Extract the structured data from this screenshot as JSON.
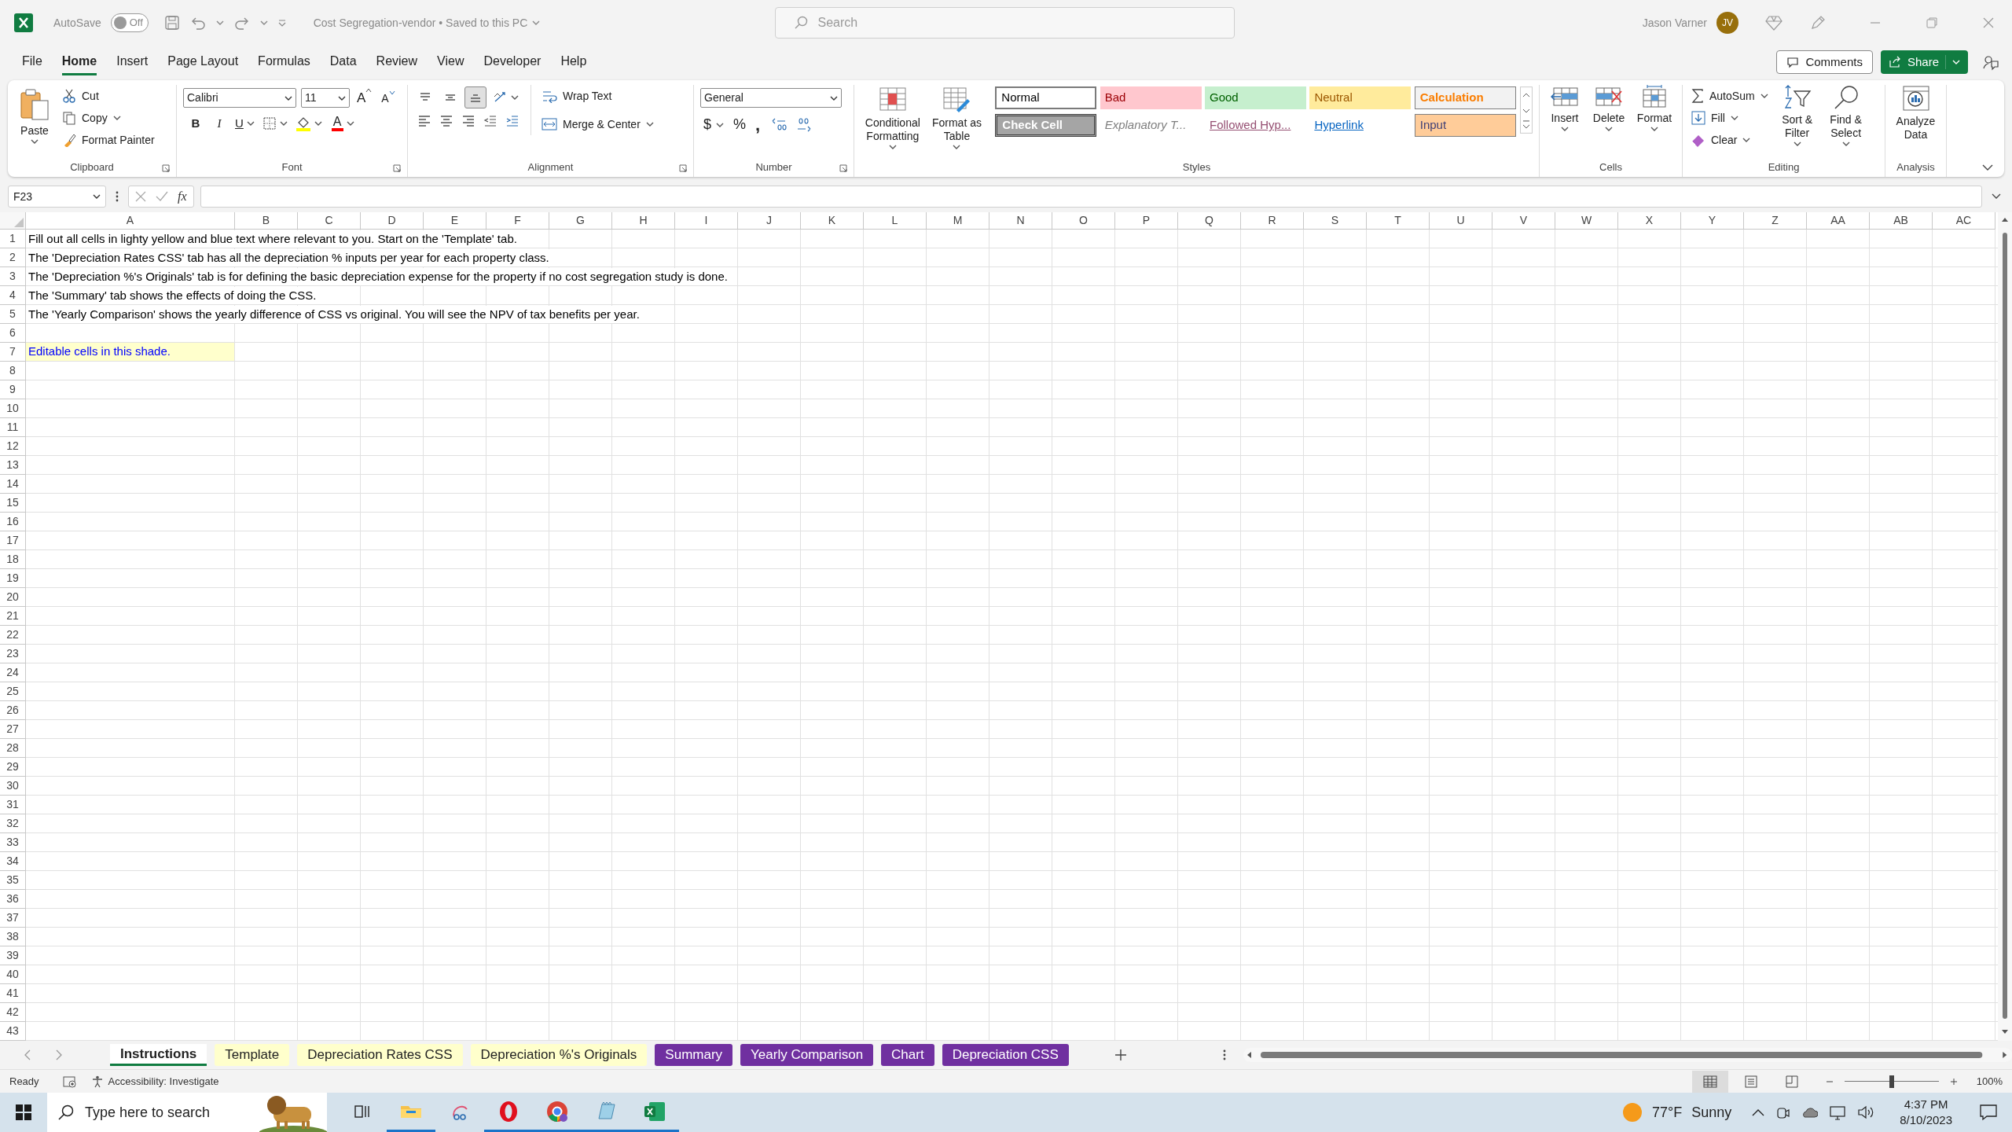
{
  "title_bar": {
    "autosave_label": "AutoSave",
    "autosave_toggle": {
      "label": "Off",
      "on": false
    },
    "document_title": "Cost Segregation-vendor • Saved to this PC",
    "search_placeholder": "Search",
    "user_name": "Jason Varner",
    "avatar_initials": "JV"
  },
  "menu_tabs": [
    {
      "label": "File",
      "selected": false
    },
    {
      "label": "Home",
      "selected": true
    },
    {
      "label": "Insert",
      "selected": false
    },
    {
      "label": "Page Layout",
      "selected": false
    },
    {
      "label": "Formulas",
      "selected": false
    },
    {
      "label": "Data",
      "selected": false
    },
    {
      "label": "Review",
      "selected": false
    },
    {
      "label": "View",
      "selected": false
    },
    {
      "label": "Developer",
      "selected": false
    },
    {
      "label": "Help",
      "selected": false
    }
  ],
  "comments_button": "Comments",
  "share_button": "Share",
  "ribbon": {
    "clipboard": {
      "title": "Clipboard",
      "paste": "Paste",
      "cut": "Cut",
      "copy": "Copy",
      "format_painter": "Format Painter"
    },
    "font": {
      "title": "Font",
      "font_name": "Calibri",
      "font_size": "11",
      "grow_font": "A",
      "shrink_font": "A",
      "bold": "B",
      "italic": "I",
      "underline": "U",
      "font_color": "A"
    },
    "alignment": {
      "title": "Alignment",
      "vertical_align": [
        {
          "kind": "top",
          "selected": false
        },
        {
          "kind": "middle",
          "selected": false
        },
        {
          "kind": "bottom",
          "selected": true
        }
      ],
      "wrap_text": "Wrap Text",
      "merge_center": "Merge & Center"
    },
    "number": {
      "title": "Number",
      "format": "General",
      "currency": "$",
      "percent": "%",
      "comma": ","
    },
    "styles": {
      "title": "Styles",
      "conditional_formatting": "Conditional Formatting",
      "format_as_table": "Format as Table",
      "items": [
        {
          "label": "Normal",
          "kind": "normal"
        },
        {
          "label": "Bad",
          "kind": "bad"
        },
        {
          "label": "Good",
          "kind": "good"
        },
        {
          "label": "Neutral",
          "kind": "neutral"
        },
        {
          "label": "Calculation",
          "kind": "calculation"
        },
        {
          "label": "Check Cell",
          "kind": "check"
        },
        {
          "label": "Explanatory T...",
          "kind": "explanatory"
        },
        {
          "label": "Followed Hyp...",
          "kind": "followed"
        },
        {
          "label": "Hyperlink",
          "kind": "hyperlink"
        },
        {
          "label": "Input",
          "kind": "input"
        }
      ]
    },
    "cells": {
      "title": "Cells",
      "insert": "Insert",
      "delete": "Delete",
      "format": "Format"
    },
    "editing": {
      "title": "Editing",
      "autosum": "AutoSum",
      "fill": "Fill",
      "clear": "Clear",
      "sort_filter": "Sort & Filter",
      "find_select": "Find & Select"
    },
    "analysis": {
      "title": "Analysis",
      "analyze_data": "Analyze Data"
    }
  },
  "formula_bar": {
    "name_box": "F23",
    "function_label": "fx"
  },
  "sheet": {
    "columns": [
      "A",
      "B",
      "C",
      "D",
      "E",
      "F",
      "G",
      "H",
      "I",
      "J",
      "K",
      "L",
      "M",
      "N",
      "O",
      "P",
      "Q",
      "R",
      "S",
      "T",
      "U",
      "V",
      "W",
      "X",
      "Y",
      "Z",
      "AA",
      "AB",
      "AC"
    ],
    "rows": [
      {
        "number": "1",
        "kind": "text",
        "text": "Fill out all cells in lighty yellow and blue text where relevant to you. Start on the 'Template' tab."
      },
      {
        "number": "2",
        "kind": "text",
        "text": "The 'Depreciation Rates CSS' tab has all the depreciation % inputs per year for each property class."
      },
      {
        "number": "3",
        "kind": "text",
        "text": "The 'Depreciation %'s Originals' tab is for defining the basic depreciation expense for the property if no cost segregation study is done."
      },
      {
        "number": "4",
        "kind": "text",
        "text": "The 'Summary' tab shows the effects of doing the CSS."
      },
      {
        "number": "5",
        "kind": "text",
        "text": "The 'Yearly Comparison' shows the yearly difference of CSS vs original. You will see the NPV of tax benefits per year."
      },
      {
        "number": "6"
      },
      {
        "number": "7",
        "kind": "editable",
        "text": "Editable cells in this shade."
      },
      {
        "number": "8"
      },
      {
        "number": "9"
      },
      {
        "number": "10"
      },
      {
        "number": "11"
      },
      {
        "number": "12"
      },
      {
        "number": "13"
      },
      {
        "number": "14"
      },
      {
        "number": "15"
      },
      {
        "number": "16"
      },
      {
        "number": "17"
      },
      {
        "number": "18"
      },
      {
        "number": "19"
      },
      {
        "number": "20"
      },
      {
        "number": "21"
      },
      {
        "number": "22"
      },
      {
        "number": "23"
      },
      {
        "number": "24"
      },
      {
        "number": "25"
      },
      {
        "number": "26"
      },
      {
        "number": "27"
      },
      {
        "number": "28"
      },
      {
        "number": "29"
      },
      {
        "number": "30"
      },
      {
        "number": "31"
      },
      {
        "number": "32"
      },
      {
        "number": "33"
      },
      {
        "number": "34"
      },
      {
        "number": "35"
      },
      {
        "number": "36"
      },
      {
        "number": "37"
      },
      {
        "number": "38"
      },
      {
        "number": "39"
      },
      {
        "number": "40"
      },
      {
        "number": "41"
      },
      {
        "number": "42"
      },
      {
        "number": "43"
      }
    ]
  },
  "sheet_tabs": [
    {
      "label": "Instructions",
      "selected": true,
      "color": "#ffffff"
    },
    {
      "label": "Template",
      "selected": false,
      "color": "#ffffcc"
    },
    {
      "label": "Depreciation Rates CSS",
      "selected": false,
      "color": "#ffffcc"
    },
    {
      "label": "Depreciation %'s Originals",
      "selected": false,
      "color": "#ffffcc"
    },
    {
      "label": "Summary",
      "selected": false,
      "color": "#7030a0"
    },
    {
      "label": "Yearly Comparison",
      "selected": false,
      "color": "#7030a0"
    },
    {
      "label": "Chart",
      "selected": false,
      "color": "#7030a0"
    },
    {
      "label": "Depreciation CSS",
      "selected": false,
      "color": "#7030a0"
    }
  ],
  "status_bar": {
    "mode": "Ready",
    "accessibility": "Accessibility: Investigate",
    "views": [
      {
        "kind": "normal",
        "selected": true
      },
      {
        "kind": "page_layout",
        "selected": false
      },
      {
        "kind": "page_break",
        "selected": false
      }
    ],
    "zoom": {
      "level": 0.5,
      "label": "100%"
    }
  },
  "taskbar": {
    "search_placeholder": "Type here to search",
    "apps": [
      {
        "kind": "task_view",
        "running": false
      },
      {
        "kind": "file_explorer",
        "running": true
      },
      {
        "kind": "snipping",
        "running": false
      },
      {
        "kind": "opera",
        "running": true
      },
      {
        "kind": "chrome",
        "running": true
      },
      {
        "kind": "notepad",
        "running": true
      },
      {
        "kind": "excel",
        "running": true
      }
    ],
    "temperature": "77°F",
    "weather": "Sunny",
    "time": "4:37 PM",
    "date": "8/10/2023"
  }
}
